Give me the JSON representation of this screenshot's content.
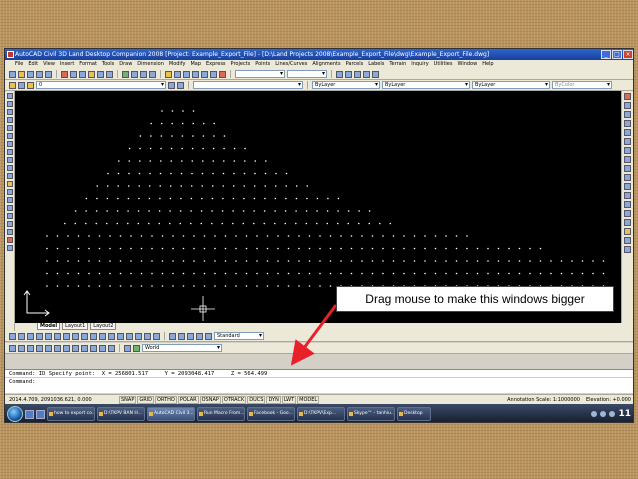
{
  "window": {
    "title": "AutoCAD Civil 3D Land Desktop Companion 2008 [Project: Example_Export_File] - [D:\\Land Projects 2008\\Example_Export_File\\dwg\\Example_Export_File.dwg]"
  },
  "menu": {
    "items": [
      "File",
      "Edit",
      "View",
      "Insert",
      "Format",
      "Tools",
      "Draw",
      "Dimension",
      "Modify",
      "Map",
      "Express",
      "Projects",
      "Points",
      "Lines/Curves",
      "Alignments",
      "Parcels",
      "Labels",
      "Terrain",
      "Inquiry",
      "Utilities",
      "Window",
      "Help"
    ]
  },
  "toolbars": {
    "layer_value": "0",
    "color_value": "ByLayer",
    "linetype_value": "ByLayer",
    "lineweight_value": "ByLayer",
    "plotstyle_value": "ByColor",
    "textstyle_value": "Standard",
    "ucs_value": "World"
  },
  "layout_tabs": [
    "Model",
    "Layout1",
    "Layout2"
  ],
  "command": {
    "line1": "Command: ID Specify point:  X = 256801.517     Y = 2093048.417     Z = 564.499",
    "line2": "Command:"
  },
  "status": {
    "coords": "2014.4.709, 2091036.621, 0.000",
    "modes": [
      "SNAP",
      "GRID",
      "ORTHO",
      "POLAR",
      "OSNAP",
      "OTRACK",
      "DUCS",
      "DYN",
      "LWT",
      "MODEL"
    ],
    "annotation_scale": "Annotation Scale: 1:1000000",
    "elevation": "Elevation: +0.000"
  },
  "taskbar": {
    "buttons": [
      "how to export co...",
      "D:\\TKPV BAN H...",
      "AutoCAD Civil 3...",
      "Run Macro From...",
      "Facebook - Goo...",
      "D:\\TKPV\\Exp...",
      "Skype™ - tanhiu...",
      "Desktop"
    ],
    "clock": "11"
  },
  "callout": {
    "text": "Drag mouse to make this windows bigger",
    "color": "#e8202a"
  }
}
